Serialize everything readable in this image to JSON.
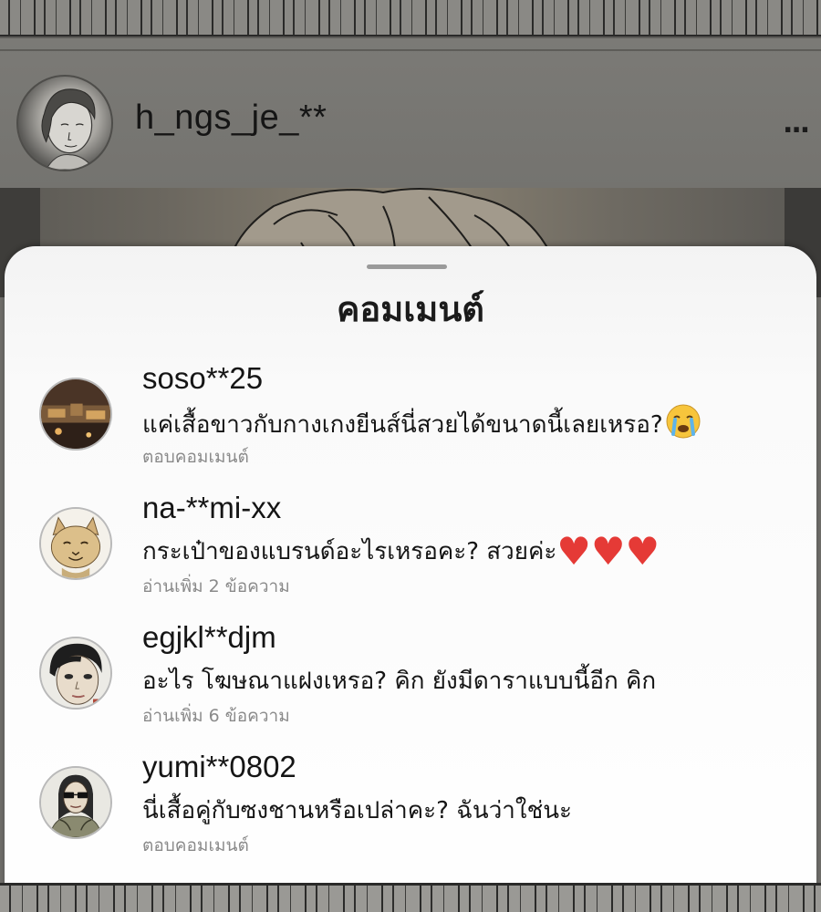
{
  "post": {
    "username": "h_ngs_je_**",
    "more_label": "..."
  },
  "sheet": {
    "title": "คอมเมนต์"
  },
  "comments": [
    {
      "username": "soso**25",
      "text": "แค่เสื้อขาวกับกางเกงยีนส์นี่สวยได้ขนาดนี้เลยเหรอ?",
      "emoji": "crying-face-emoji",
      "action": "ตอบคอมเมนต์"
    },
    {
      "username": "na-**mi-xx",
      "text": "กระเป๋าของแบรนด์อะไรเหรอคะ? สวยค่ะ",
      "hearts": "♥♥♥",
      "action": "อ่านเพิ่ม 2 ข้อความ"
    },
    {
      "username": "egjkl**djm",
      "text": "อะไร โฆษณาแฝงเหรอ? คิก ยังมีดาราแบบนี้อีก คิก",
      "action": "อ่านเพิ่ม 6 ข้อความ"
    },
    {
      "username": "yumi**0802",
      "text": "นี่เสื้อคู่กับซงชานหรือเปล่าคะ? ฉันว่าใช่นะ",
      "action": "ตอบคอมเมนต์"
    }
  ],
  "colors": {
    "heart": "#e53a36",
    "secondary_text": "#8a8a8a"
  }
}
